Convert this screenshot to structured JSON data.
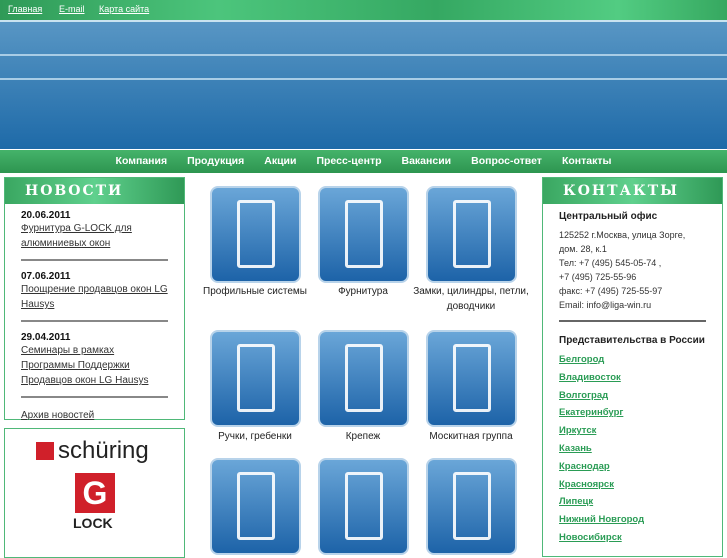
{
  "top_links": [
    "Главная",
    "E-mail",
    "Карта сайта"
  ],
  "nav": [
    "Компания",
    "Продукция",
    "Акции",
    "Пресс-центр",
    "Вакансии",
    "Вопрос-ответ",
    "Контакты"
  ],
  "news": {
    "title": "НОВОСТИ",
    "items": [
      {
        "date": "20.06.2011",
        "text": "Фурнитура G-LOCK для алюминиевых окон"
      },
      {
        "date": "07.06.2011",
        "text": "Поощрение продавцов окон LG Hausys"
      },
      {
        "date": "29.04.2011",
        "text": "Семинары в рамках Программы Поддержки Продавцов окон LG Hausys"
      }
    ],
    "archive": "Архив новостей"
  },
  "logos": [
    "schüring",
    "G",
    "LOCK"
  ],
  "products": [
    {
      "label": "Профильные системы",
      "icon": "profile-icon"
    },
    {
      "label": "Фурнитура",
      "icon": "hardware-icon"
    },
    {
      "label": "Замки, цилиндры, петли, доводчики",
      "icon": "lock-icon"
    },
    {
      "label": "Ручки, гребенки",
      "icon": "handle-icon"
    },
    {
      "label": "Крепеж",
      "icon": "screw-icon"
    },
    {
      "label": "Москитная группа",
      "icon": "mesh-icon"
    },
    {
      "label": "",
      "icon": "flask-icon"
    },
    {
      "label": "",
      "icon": "tool-icon"
    },
    {
      "label": "",
      "icon": "saw-icon"
    }
  ],
  "contacts": {
    "title": "КОНТАКТЫ",
    "office_title": "Центральный офис",
    "lines": [
      "125252 г.Москва, улица Зорге,",
      "дом. 28, к.1",
      "Тел: +7 (495) 545-05-74 ,",
      "+7 (495) 725-55-96",
      "факс: +7 (495) 725-55-97",
      "Email: info@liga-win.ru"
    ],
    "reps_title": "Представительства в России",
    "cities": [
      "Белгород",
      "Владивосток",
      "Волгоград",
      "Екатеринбург",
      "Иркутск",
      "Казань",
      "Краснодар",
      "Красноярск",
      "Липецк",
      "Нижний Новгород",
      "Новосибирск"
    ]
  }
}
